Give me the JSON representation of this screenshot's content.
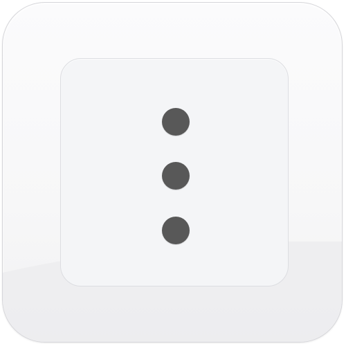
{
  "icon": {
    "name": "more-vertical-icon",
    "colors": {
      "tile_background": "#f7f7f8",
      "tile_border": "#d6d6da",
      "panel_background": "#f4f5f7",
      "panel_border": "#dcdde1",
      "dot": "#585858"
    }
  }
}
